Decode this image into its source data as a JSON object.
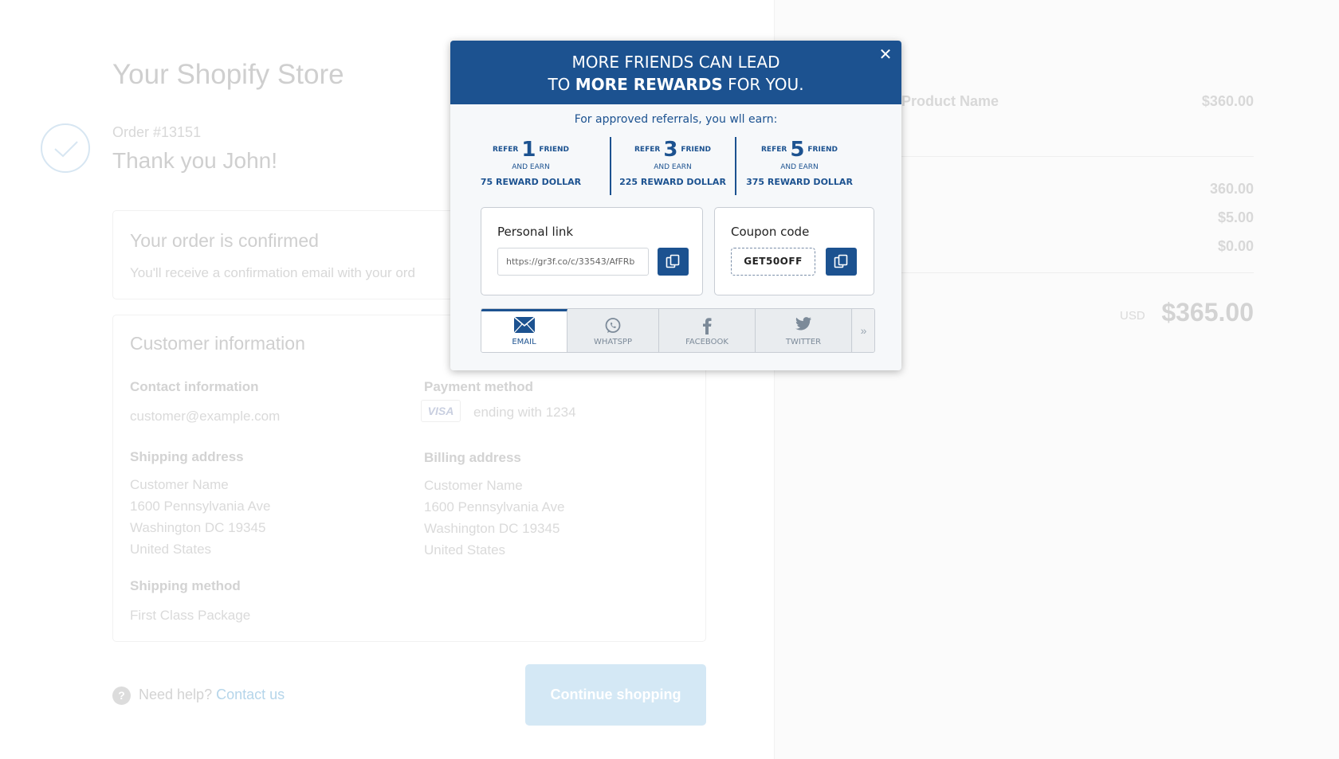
{
  "store": {
    "title": "Your Shopify Store",
    "order_number": "Order #13151",
    "thank_you": "Thank you John!"
  },
  "confirmation": {
    "title": "Your order is confirmed",
    "text": "You'll receive a confirmation email with your ord"
  },
  "customer": {
    "title": "Customer information",
    "contact_label": "Contact information",
    "contact_value": "customer@example.com",
    "payment_label": "Payment method",
    "card_brand": "VISA",
    "card_ending": "ending with 1234",
    "shipping_label": "Shipping address",
    "shipping_lines": [
      "Customer Name",
      "1600 Pennsylvania Ave",
      "Washington DC 19345",
      "United States"
    ],
    "billing_label": "Billing address",
    "billing_lines": [
      "Customer Name",
      "1600 Pennsylvania Ave",
      "Washington DC 19345",
      "United States"
    ],
    "shipping_method_label": "Shipping method",
    "shipping_method_value": "First Class Package"
  },
  "footer": {
    "help_icon": "?",
    "help_text": "Need help?",
    "help_link": "Contact us",
    "continue_label": "Continue shopping"
  },
  "summary": {
    "product_name": "Product Name",
    "product_price": "$360.00",
    "subtotal": "360.00",
    "shipping": "$5.00",
    "taxes": "$0.00",
    "currency": "USD",
    "total": "$365.00"
  },
  "modal": {
    "header_line1": "MORE FRIENDS CAN LEAD",
    "header_line2_pre": "TO ",
    "header_line2_strong": "MORE REWARDS",
    "header_line2_post": " FOR YOU.",
    "close_symbol": "✕",
    "subtitle": "For approved referrals, you wll earn:",
    "tiers": [
      {
        "refer": "REFER",
        "count": "1",
        "friend": "FRIEND",
        "earn": "AND EARN",
        "reward": "75 REWARD DOLLAR"
      },
      {
        "refer": "REFER",
        "count": "3",
        "friend": "FRIEND",
        "earn": "AND EARN",
        "reward": "225 REWARD DOLLAR"
      },
      {
        "refer": "REFER",
        "count": "5",
        "friend": "FRIEND",
        "earn": "AND EARN",
        "reward": "375 REWARD DOLLAR"
      }
    ],
    "personal_link": {
      "title": "Personal link",
      "value": "https://gr3f.co/c/33543/AfFRb"
    },
    "coupon": {
      "title": "Coupon code",
      "code": "GET50OFF"
    },
    "share_tabs": [
      {
        "label": "EMAIL",
        "icon": "envelope-icon"
      },
      {
        "label": "WHATSPP",
        "icon": "whatsapp-icon"
      },
      {
        "label": "FACEBOOK",
        "icon": "facebook-icon"
      },
      {
        "label": "TWITTER",
        "icon": "twitter-icon"
      }
    ],
    "more_symbol": "»"
  },
  "colors": {
    "brand_blue": "#1c5290",
    "button_light": "#d4e8f5"
  }
}
